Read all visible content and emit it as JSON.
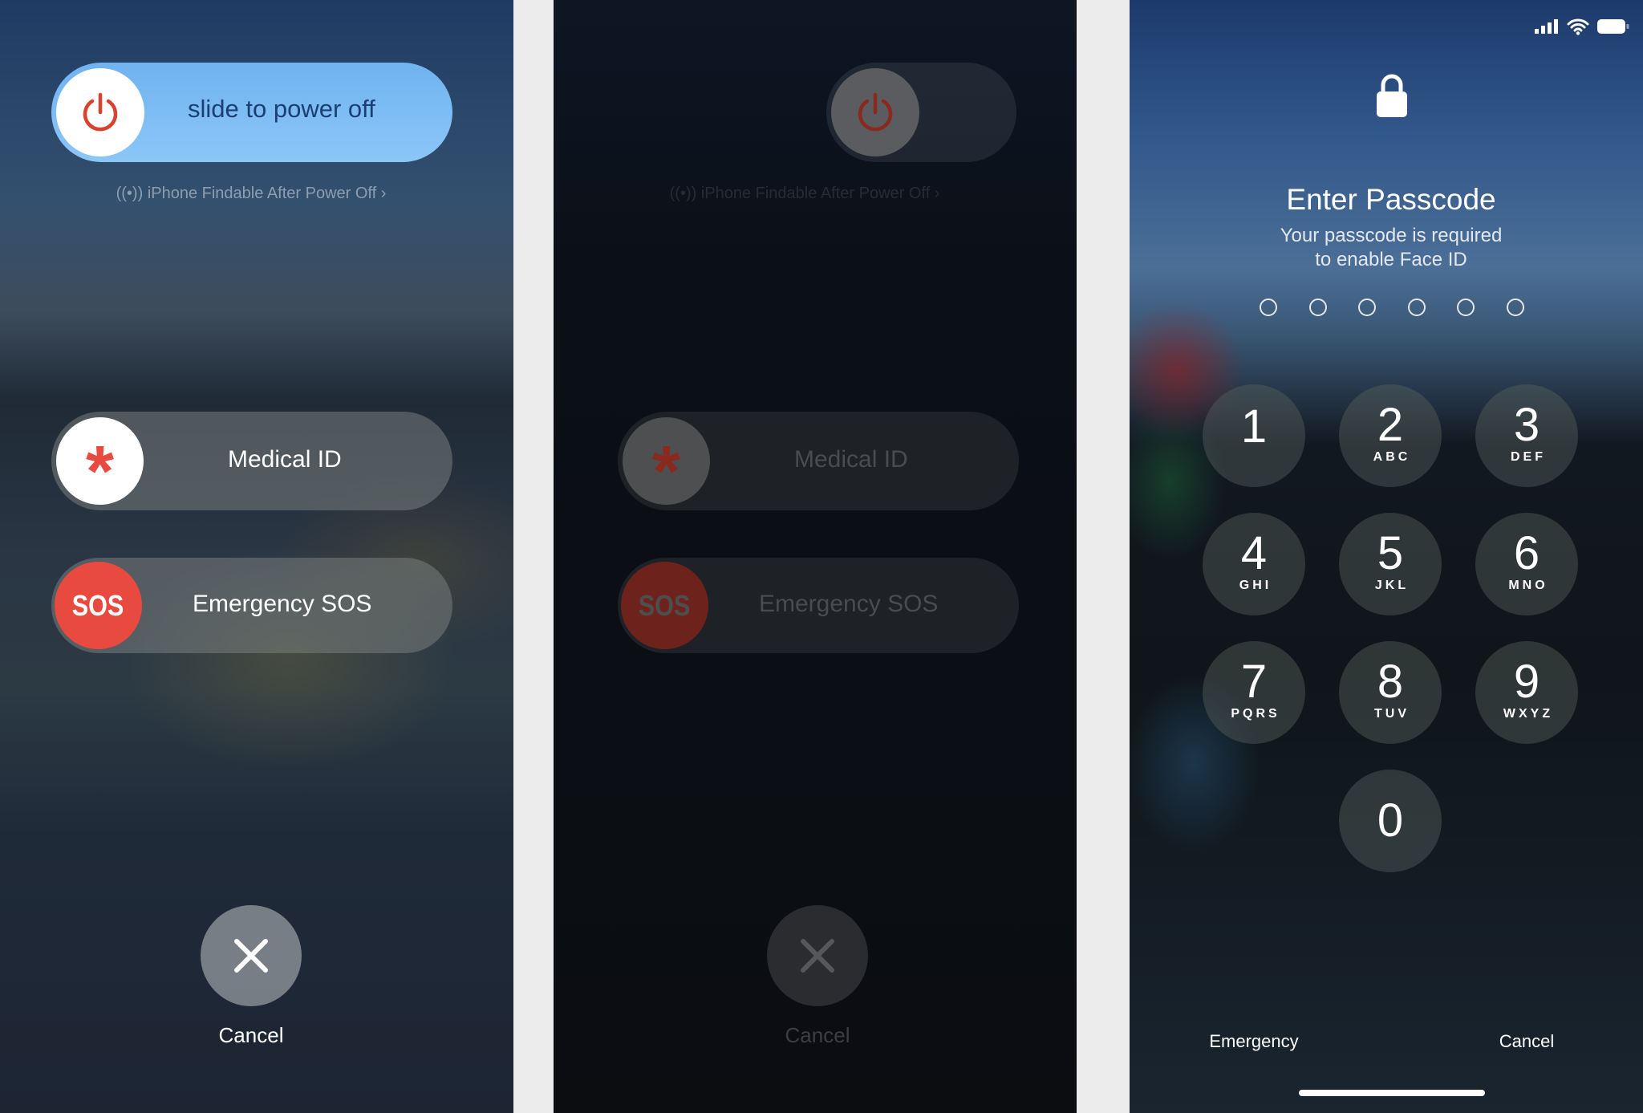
{
  "power_screen": {
    "slider_label": "slide to power off",
    "findable_text": "iPhone Findable After Power Off",
    "medical_id_label": "Medical ID",
    "sos_icon_text": "SOS",
    "sos_label": "Emergency SOS",
    "cancel_label": "Cancel"
  },
  "dimmed_screen": {
    "findable_text": "iPhone Findable After Power Off",
    "medical_id_label": "Medical ID",
    "sos_icon_text": "SOS",
    "sos_label": "Emergency SOS",
    "cancel_label": "Cancel"
  },
  "passcode_screen": {
    "title": "Enter Passcode",
    "subtitle_line1": "Your passcode is required",
    "subtitle_line2": "to enable Face ID",
    "passcode_length": 6,
    "keys": [
      {
        "digit": "1",
        "letters": ""
      },
      {
        "digit": "2",
        "letters": "ABC"
      },
      {
        "digit": "3",
        "letters": "DEF"
      },
      {
        "digit": "4",
        "letters": "GHI"
      },
      {
        "digit": "5",
        "letters": "JKL"
      },
      {
        "digit": "6",
        "letters": "MNO"
      },
      {
        "digit": "7",
        "letters": "PQRS"
      },
      {
        "digit": "8",
        "letters": "TUV"
      },
      {
        "digit": "9",
        "letters": "WXYZ"
      },
      {
        "digit": "0",
        "letters": ""
      }
    ],
    "emergency_label": "Emergency",
    "cancel_label": "Cancel"
  },
  "colors": {
    "power_red": "#d8432f",
    "sos_red": "#e84a3f",
    "slider_blue": "#7fbdf4"
  },
  "icons": [
    "power-icon",
    "asterisk-icon",
    "close-icon",
    "lock-icon",
    "signal-icon",
    "wifi-icon",
    "battery-icon",
    "chevron-right-icon",
    "findmy-icon"
  ]
}
